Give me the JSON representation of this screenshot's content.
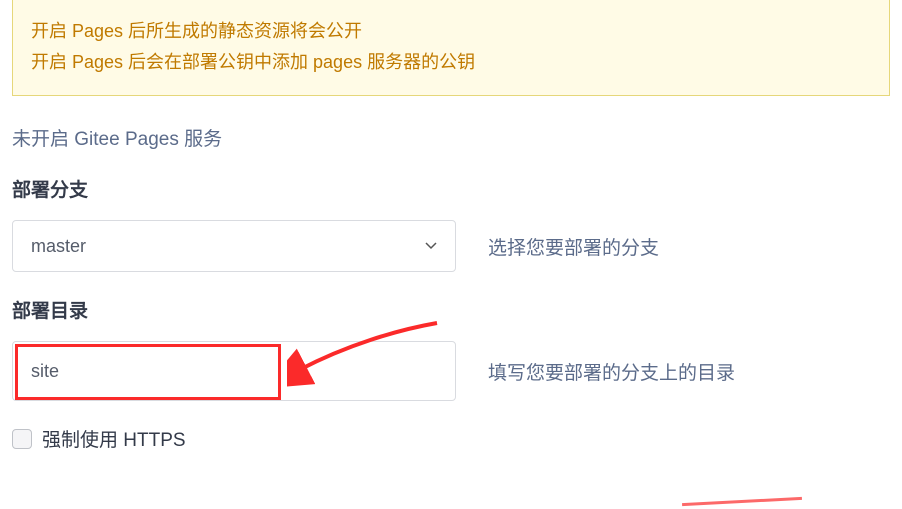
{
  "notice": {
    "line1": "开启 Pages 后所生成的静态资源将会公开",
    "line2": "开启 Pages 后会在部署公钥中添加 pages 服务器的公钥"
  },
  "status_text": "未开启 Gitee Pages 服务",
  "branch": {
    "label": "部署分支",
    "selected": "master",
    "hint": "选择您要部署的分支"
  },
  "directory": {
    "label": "部署目录",
    "value": "site",
    "hint": "填写您要部署的分支上的目录"
  },
  "https": {
    "label": "强制使用 HTTPS",
    "checked": false
  },
  "colors": {
    "notice_bg": "#fffbe6",
    "notice_border": "#e6d77a",
    "notice_text": "#c07a00",
    "highlight": "#fb2a2a"
  }
}
